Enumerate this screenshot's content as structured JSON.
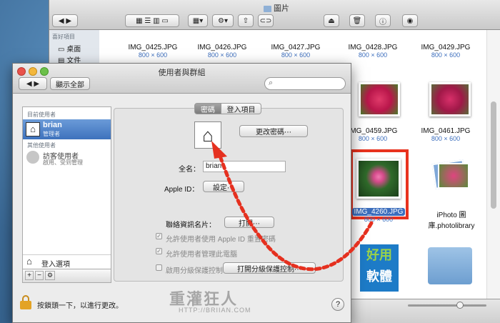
{
  "finder": {
    "title": "圖片",
    "sidebar_header": "喜好項目",
    "sidebar_items": [
      "桌面",
      "文件"
    ],
    "row1": [
      {
        "name": "IMG_0425.JPG",
        "size": "800 × 600"
      },
      {
        "name": "IMG_0426.JPG",
        "size": "800 × 600"
      },
      {
        "name": "IMG_0427.JPG",
        "size": "800 × 600"
      },
      {
        "name": "IMG_0428.JPG",
        "size": "800 × 600"
      },
      {
        "name": "IMG_0429.JPG",
        "size": "800 × 600"
      }
    ],
    "row2": [
      {
        "name": "IMG_0459.JPG",
        "size": "800 × 600"
      },
      {
        "name": "IMG_0461.JPG",
        "size": "800 × 600"
      }
    ],
    "row3": [
      {
        "name": "IMG_4260.JPG",
        "size": "800 × 600"
      },
      {
        "name": "iPhoto 圖庫.photolibrary",
        "size": ""
      }
    ],
    "app_label_1": "好用",
    "app_label_2": "軟體"
  },
  "prefs": {
    "title": "使用者與群組",
    "show_all": "顯示全部",
    "search_placeholder": "",
    "current_users_header": "目前使用者",
    "current_user_name": "brian",
    "current_user_role": "管理者",
    "other_users_header": "其他使用者",
    "guest_name": "訪客使用者",
    "guest_desc": "啟用、受到管理",
    "login_options": "登入選項",
    "tabs": [
      "密碼",
      "登入項目"
    ],
    "change_password": "更改密碼⋯",
    "fullname_label": "全名：",
    "fullname_value": "brian",
    "appleid_label": "Apple ID：",
    "appleid_button": "設定⋯",
    "contact_label": "聯絡資訊名片：",
    "contact_button": "打開⋯",
    "opt1": "允許使用者使用 Apple ID 重置密碼",
    "opt2": "允許使用者管理此電腦",
    "opt3": "啟用分級保護控制",
    "parental_button": "打開分級保護控制⋯",
    "lock_text": "按鎖頭一下，以進行更改。",
    "help": "?"
  },
  "watermark": {
    "line1": "重灌狂人",
    "line2": "HTTP://BRIIAN.COM"
  },
  "colors": {
    "highlight": "#e8321e",
    "arrow": "#e5301f",
    "accent": "#3c6ebd"
  }
}
